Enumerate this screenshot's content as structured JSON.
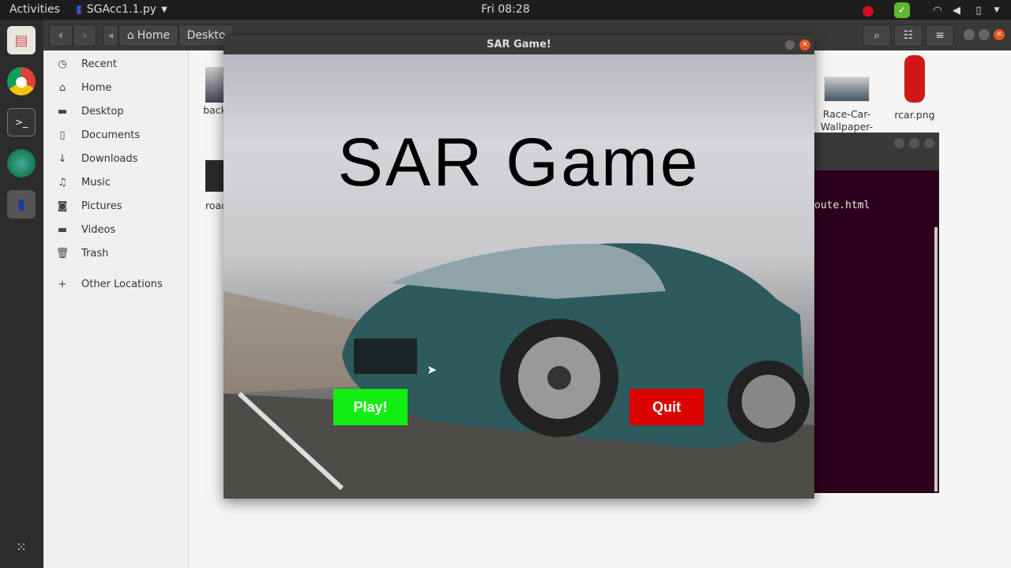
{
  "topbar": {
    "activities": "Activities",
    "app_name": "SGAcc1.1.py",
    "clock": "Fri 08:28"
  },
  "file_manager": {
    "path": [
      "Home",
      "Deskto"
    ],
    "sidebar": [
      {
        "label": "Recent",
        "icon": "clock-icon"
      },
      {
        "label": "Home",
        "icon": "home-icon"
      },
      {
        "label": "Desktop",
        "icon": "folder-icon"
      },
      {
        "label": "Documents",
        "icon": "document-icon"
      },
      {
        "label": "Downloads",
        "icon": "download-icon"
      },
      {
        "label": "Music",
        "icon": "music-icon"
      },
      {
        "label": "Pictures",
        "icon": "camera-icon"
      },
      {
        "label": "Videos",
        "icon": "video-icon"
      },
      {
        "label": "Trash",
        "icon": "trash-icon"
      },
      {
        "label": "Other Locations",
        "icon": "plus-icon"
      }
    ],
    "files": [
      {
        "name": "back d."
      },
      {
        "name": "road p"
      },
      {
        "name": "Race-Car-Wallpaper-"
      },
      {
        "name": "rcar.png"
      }
    ]
  },
  "terminal": {
    "text": "oute.html"
  },
  "game": {
    "window_title": "SAR Game!",
    "headline": "SAR Game",
    "play_label": "Play!",
    "quit_label": "Quit",
    "colors": {
      "play": "#11ee11",
      "quit": "#dd0000"
    }
  }
}
